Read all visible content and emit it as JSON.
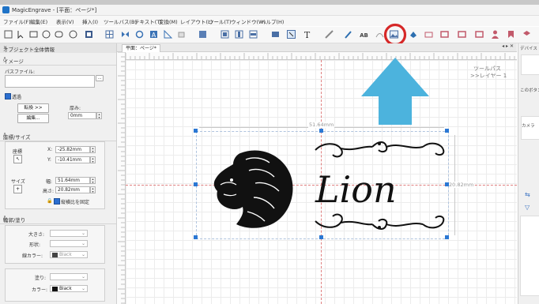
{
  "window": {
    "title": "MagicEngrave - [平面：ページ*]"
  },
  "menu": [
    "ファイル(F)",
    "編集(E)",
    "表示(V)",
    "挿入(I)",
    "ツールバス(B)",
    "テキスト(T)",
    "変換(M)",
    "レイアウト(L)",
    "ツール(T)",
    "ウィンドウ(W)",
    "ヘルプ(H)"
  ],
  "left_panel": {
    "title": "オブジェクト全体情報",
    "image": {
      "header": "イメージ",
      "path_label": "パスファイル:",
      "path_button": "...",
      "transparent_label": "透過",
      "convert_button": "転換 >>",
      "edit_button": "編集...",
      "thickness_label": "厚み:",
      "thickness_value": "0mm"
    },
    "geometry": {
      "header": "座標/サイズ",
      "coord_label": "座標",
      "x_label": "X:",
      "x_value": "-25.82mm",
      "y_label": "Y:",
      "y_value": "-10.41mm",
      "size_label": "サイズ",
      "width_label": "幅:",
      "width_value": "51.64mm",
      "height_label": "高さ:",
      "height_value": "20.82mm",
      "lock_ratio_label": "縦横比を固定"
    },
    "outline_fill": {
      "header": "輪郭/塗り",
      "size_label": "大きさ:",
      "shape_label": "形状:",
      "outline_color_label": "線カラー:",
      "outline_color_value": "Black",
      "fill_label": "塗り:",
      "color_label": "カラー:",
      "color_value": "Black"
    }
  },
  "document_tab": {
    "label": "平面：ページ*",
    "controls": "◂ ▸ ✕"
  },
  "canvas": {
    "layer_label_1": "ツールパス",
    "layer_label_2": ">>レイヤー 1",
    "dimension_width": "51.64mm",
    "dimension_height": "20.82mm",
    "artwork_text": "Lion"
  },
  "right_panel": {
    "header": "デバイス",
    "item1": "このボタン...",
    "item2": "カメラ"
  },
  "colors": {
    "selection_handle": "#2b78d4",
    "highlight_circle": "#d62828",
    "arrow": "#4cb3dd",
    "lion_fill": "#111111"
  },
  "icons": [
    "new-icon",
    "rectangle-icon",
    "ellipse-icon",
    "polygon-icon",
    "grid-icon",
    "image-icon",
    "align-icon",
    "text-icon",
    "laser-icon",
    "insert-image-icon"
  ]
}
